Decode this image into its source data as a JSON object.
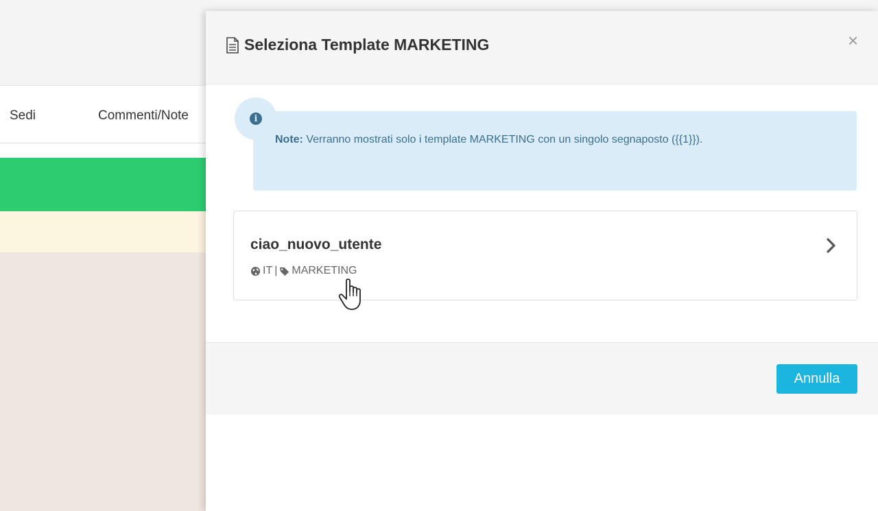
{
  "background": {
    "tabs": [
      {
        "label": "Sedi"
      },
      {
        "label": "Commenti/Note"
      }
    ]
  },
  "modal": {
    "title": "Seleziona Template MARKETING",
    "title_icon": "document-icon",
    "close_label": "×",
    "note": {
      "label": "Note:",
      "text": "Verranno mostrati solo i template MARKETING con un singolo segnaposto ({{1}})."
    },
    "templates": [
      {
        "name": "ciao_nuovo_utente",
        "language": "IT",
        "separator": "|",
        "category": "MARKETING"
      }
    ],
    "footer": {
      "cancel_label": "Annulla"
    }
  },
  "colors": {
    "green_bar": "#2ecc71",
    "info_bg": "#d9ecf7",
    "info_text": "#3c6e8f",
    "button": "#1cb5e0"
  }
}
